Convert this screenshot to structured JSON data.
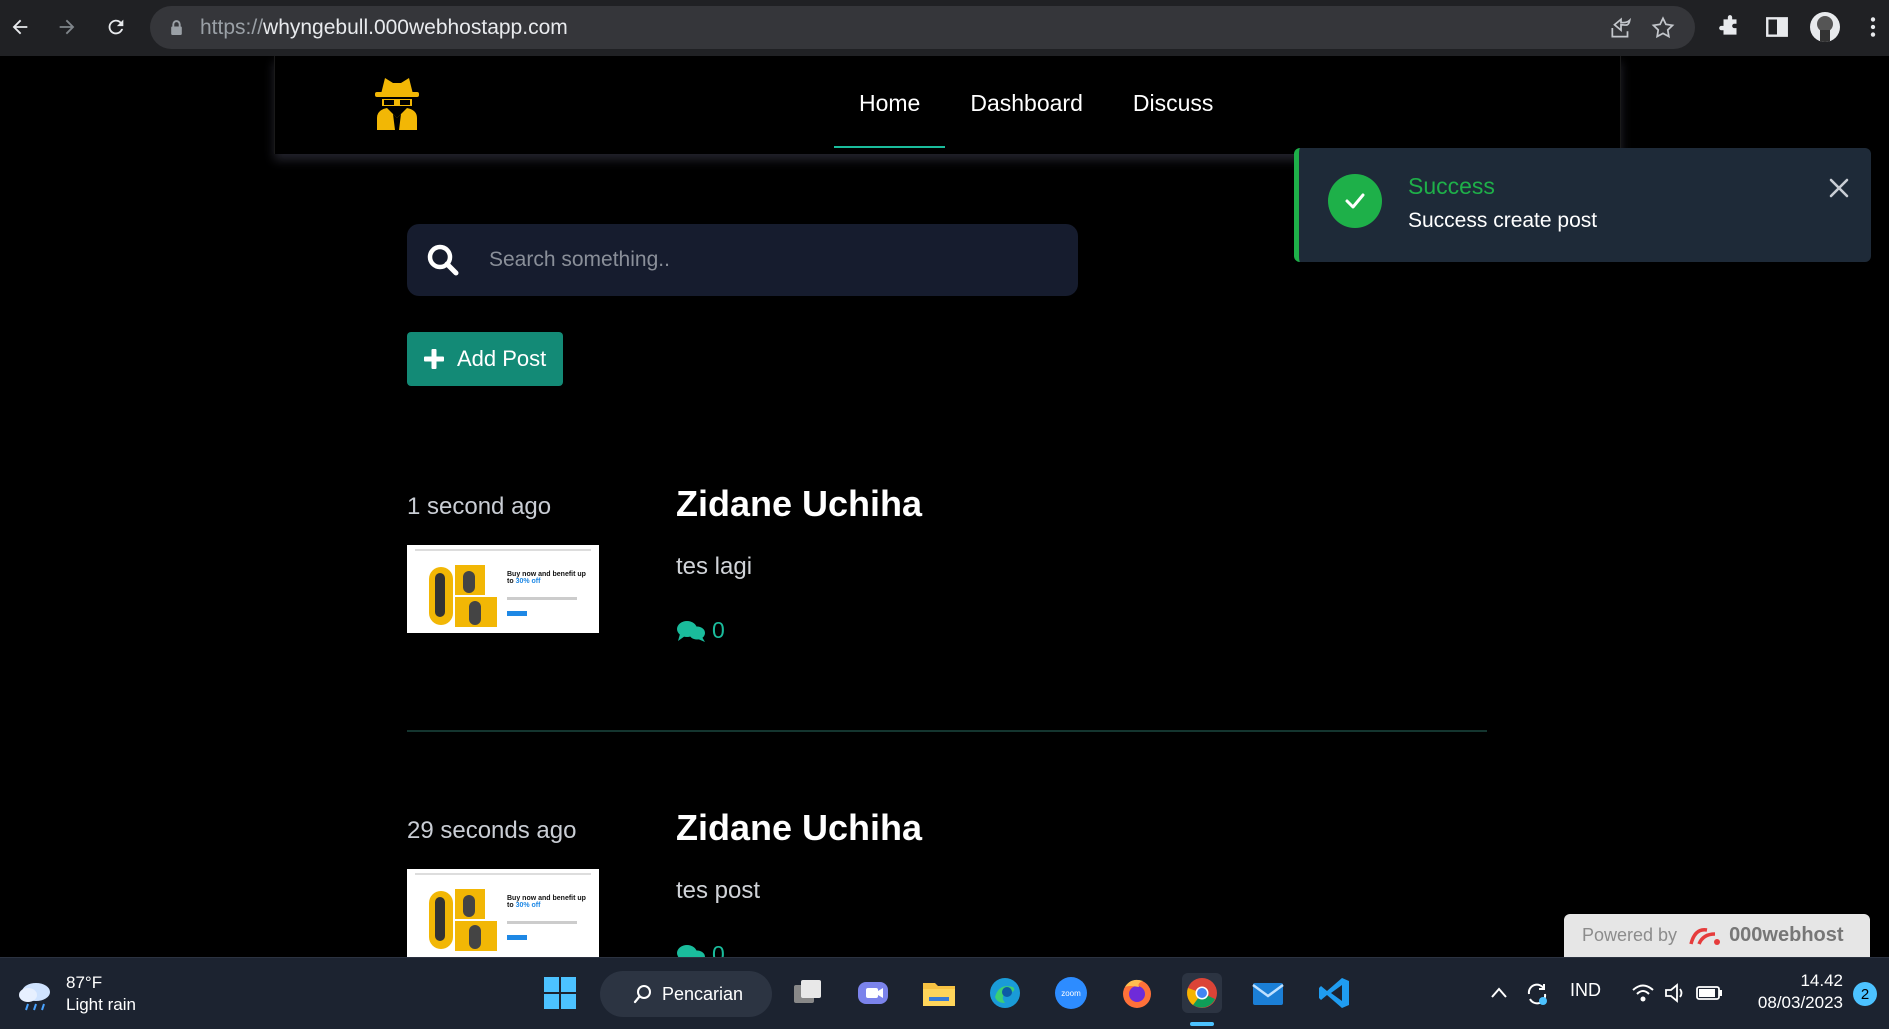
{
  "browser": {
    "url_scheme": "https://",
    "url_host": "whyngebull.000webhostapp.com"
  },
  "nav": {
    "items": [
      {
        "label": "Home",
        "active": true
      },
      {
        "label": "Dashboard",
        "active": false
      },
      {
        "label": "Discuss",
        "active": false
      }
    ]
  },
  "search": {
    "placeholder": "Search something.."
  },
  "add_post": {
    "label": "Add Post"
  },
  "posts": [
    {
      "time": "1 second ago",
      "author": "Zidane Uchiha",
      "body": "tes lagi",
      "comments": "0"
    },
    {
      "time": "29 seconds ago",
      "author": "Zidane Uchiha",
      "body": "tes post",
      "comments": "0"
    }
  ],
  "thumbnail": {
    "headline": "Buy now and benefit up to",
    "highlight": "30% off"
  },
  "toast": {
    "title": "Success",
    "message": "Success create post",
    "accent": "#1eb049"
  },
  "powered": {
    "prefix": "Powered by",
    "brand": "000webhost"
  },
  "taskbar": {
    "weather_temp": "87°F",
    "weather_desc": "Light rain",
    "search_label": "Pencarian",
    "language": "IND",
    "time": "14.42",
    "date": "08/03/2023",
    "notifications": "2"
  },
  "colors": {
    "accent": "#1abc9c",
    "button": "#138a76",
    "search_bg": "#161c2e",
    "toast_bg": "#1e2a38"
  }
}
